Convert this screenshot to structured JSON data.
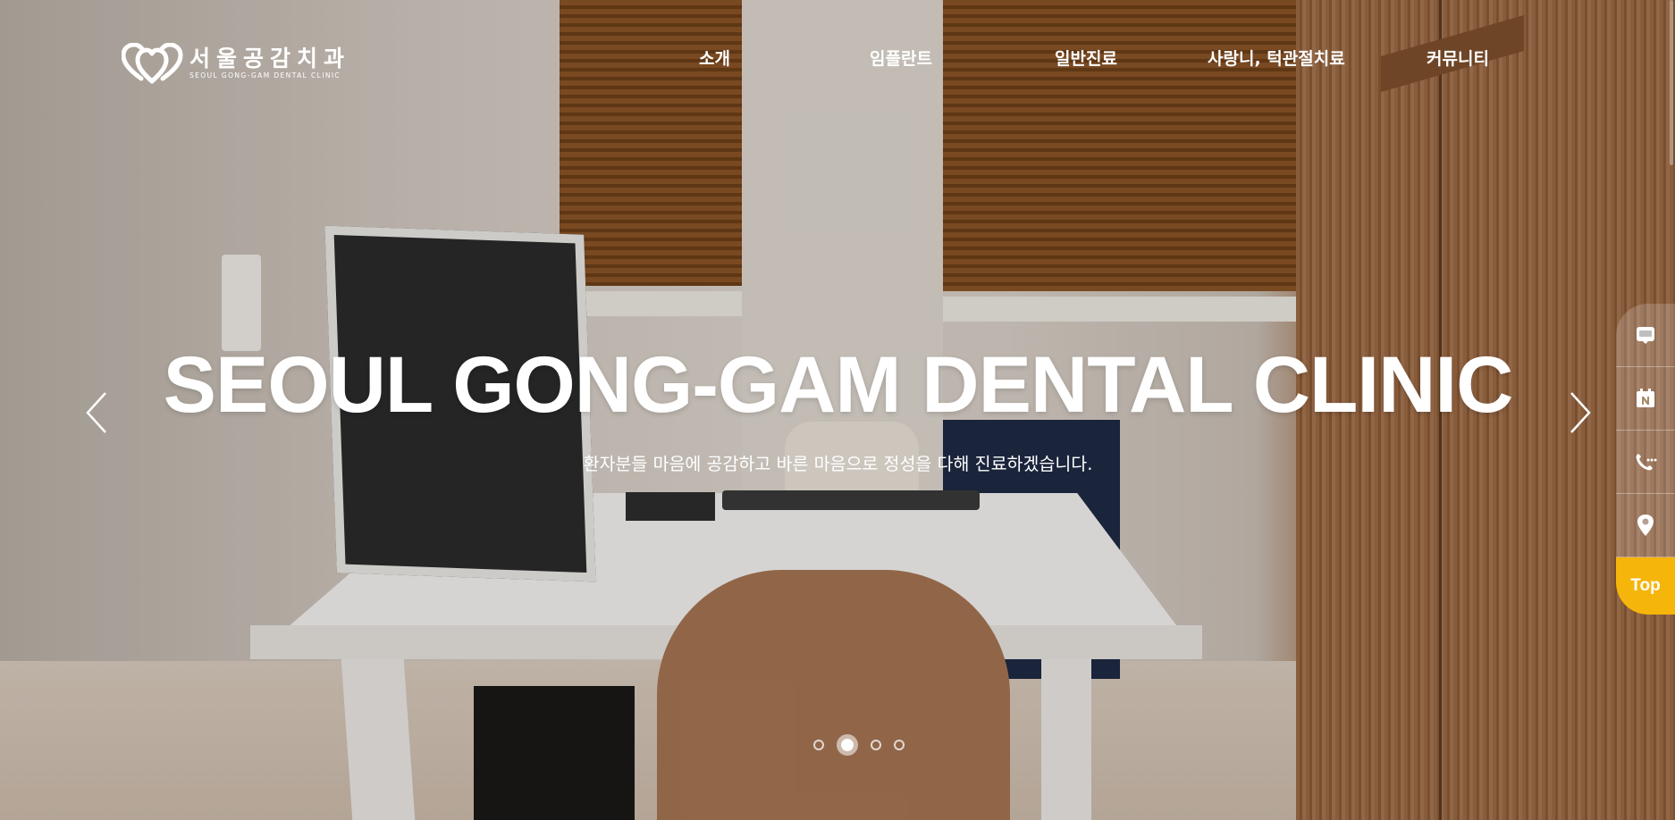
{
  "header": {
    "logo_ko": "서울공감치과",
    "logo_en": "SEOUL GONG-GAM DENTAL CLINIC",
    "nav": [
      "소개",
      "임플란트",
      "일반진료",
      "사랑니, 턱관절치료",
      "커뮤니티"
    ]
  },
  "hero": {
    "title": "SEOUL GONG-GAM DENTAL CLINIC",
    "subtitle": "환자분들 마음에 공감하고 바른 마음으로 정성을 다해 진료하겠습니다.",
    "prev_icon": "chevron-left-icon",
    "next_icon": "chevron-right-icon",
    "slides_total": 4,
    "active_slide": 2
  },
  "quick_menu": {
    "items": [
      "blog-icon",
      "naver-icon",
      "phone-icon",
      "location-pin-icon"
    ],
    "top_label": "Top"
  },
  "colors": {
    "accent": "#f5b50a",
    "text": "#ffffff"
  }
}
